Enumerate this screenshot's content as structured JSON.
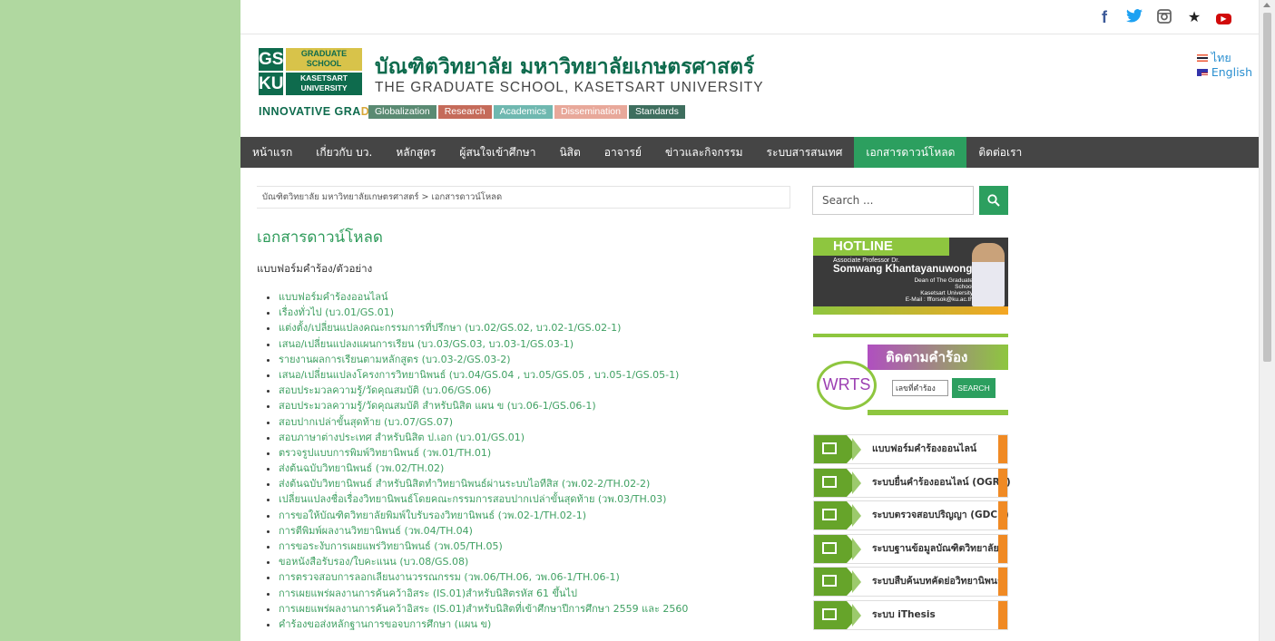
{
  "social": {
    "icons": [
      "facebook-icon",
      "twitter-icon",
      "instagram-icon",
      "star-icon",
      "youtube-icon"
    ]
  },
  "header": {
    "logo": {
      "gs": "GS",
      "ku": "KU",
      "graduate": "GRADUATE",
      "school": "SCHOOL",
      "kasetsart": "KASETSART",
      "university": "UNIVERSITY"
    },
    "tagline_part1": "INNOVATIVE GRA",
    "tagline_part2": "DS",
    "thai_title": "บัณฑิตวิทยาลัย มหาวิทยาลัยเกษตรศาสตร์",
    "english_title": "THE GRADUATE SCHOOL, KASETSART UNIVERSITY",
    "pills": [
      "Globalization",
      "Research",
      "Academics",
      "Dissemination",
      "Standards"
    ],
    "languages": [
      "ไทย",
      "English"
    ]
  },
  "nav": {
    "items": [
      "หน้าแรก",
      "เกี่ยวกับ บว.",
      "หลักสูตร",
      "ผู้สนใจเข้าศึกษา",
      "นิสิต",
      "อาจารย์",
      "ข่าวและกิจกรรม",
      "ระบบสารสนเทศ",
      "เอกสารดาวน์โหลด",
      "ติดต่อเรา"
    ],
    "active_index": 8
  },
  "main": {
    "breadcrumb": "บัณฑิตวิทยาลัย มหาวิทยาลัยเกษตรศาสตร์ > เอกสารดาวน์โหลด",
    "title": "เอกสารดาวน์โหลด",
    "section_label": "แบบฟอร์มคำร้อง/ตัวอย่าง",
    "documents": [
      "แบบฟอร์มคำร้องออนไลน์",
      "เรื่องทั่วไป (บว.01/GS.01)",
      "แต่งตั้ง/เปลี่ยนแปลงคณะกรรมการที่ปรึกษา (บว.02/GS.02, บว.02-1/GS.02-1)",
      "เสนอ/เปลี่ยนแปลงแผนการเรียน (บว.03/GS.03, บว.03-1/GS.03-1)",
      "รายงานผลการเรียนตามหลักสูตร (บว.03-2/GS.03-2)",
      "เสนอ/เปลี่ยนแปลงโครงการวิทยานิพนธ์ (บว.04/GS.04 , บว.05/GS.05 , บว.05-1/GS.05-1)",
      "สอบประมวลความรู้/วัดคุณสมบัติ (บว.06/GS.06)",
      "สอบประมวลความรู้/วัดคุณสมบัติ สำหรับนิสิต แผน ข (บว.06-1/GS.06-1)",
      "สอบปากเปล่าขั้นสุดท้าย (บว.07/GS.07)",
      "สอบภาษาต่างประเทศ สำหรับนิสิต ป.เอก (บว.01/GS.01)",
      "ตรวจรูปแบบการพิมพ์วิทยานิพนธ์ (วพ.01/TH.01)",
      "ส่งต้นฉบับวิทยานิพนธ์ (วพ.02/TH.02)",
      "ส่งต้นฉบับวิทยานิพนธ์ สำหรับนิสิตทำวิทยานิพนธ์ผ่านระบบไอทีสิส (วพ.02-2/TH.02-2)",
      "เปลี่ยนแปลงชื่อเรื่องวิทยานิพนธ์โดยคณะกรรมการสอบปากเปล่าขั้นสุดท้าย (วพ.03/TH.03)",
      "การขอให้บัณฑิตวิทยาลัยพิมพ์ใบรับรองวิทยานิพนธ์ (วพ.02-1/TH.02-1)",
      "การตีพิมพ์ผลงานวิทยานิพนธ์ (วพ.04/TH.04)",
      "การขอระงับการเผยแพร่วิทยานิพนธ์ (วพ.05/TH.05)",
      "ขอหนังสือรับรอง/ใบคะแนน (บว.08/GS.08)",
      "การตรวจสอบการลอกเลียนงานวรรณกรรม (วพ.06/TH.06, วพ.06-1/TH.06-1)",
      "การเผยแพร่ผลงานการค้นคว้าอิสระ (IS.01)สำหรับนิสิตรหัส 61 ขึ้นไป",
      "การเผยแพร่ผลงานการค้นคว้าอิสระ (IS.01)สำหรับนิสิตที่เข้าศึกษาปีการศึกษา 2559 และ 2560",
      "คำร้องขอส่งหลักฐานการขอจบการศึกษา (แผน ข)"
    ]
  },
  "sidebar": {
    "search_placeholder": "Search ...",
    "hotline": {
      "label": "HOTLINE",
      "prefix": "Associate Professor Dr.",
      "name": "Somwang Khantayanuwong",
      "role1": "Dean of The Graduate School",
      "role2": "Kasetsart University",
      "email": "E-Mail : ffforsok@ku.ac.th"
    },
    "wrts": {
      "title": "ติดตามคำร้อง",
      "logo": "WRTS",
      "input_placeholder": "เลขที่คำร้อง",
      "button": "SEARCH"
    },
    "links": [
      "แบบฟอร์มคำร้องออนไลน์",
      "ระบบยื่นคำร้องออนไลน์ (OGRF)",
      "ระบบตรวจสอบปริญญา (GDCS)",
      "ระบบฐานข้อมูลบัณฑิตวิทยาลัย",
      "ระบบสืบค้นบทคัดย่อวิทยานิพนธ์",
      "ระบบ iThesis"
    ]
  }
}
